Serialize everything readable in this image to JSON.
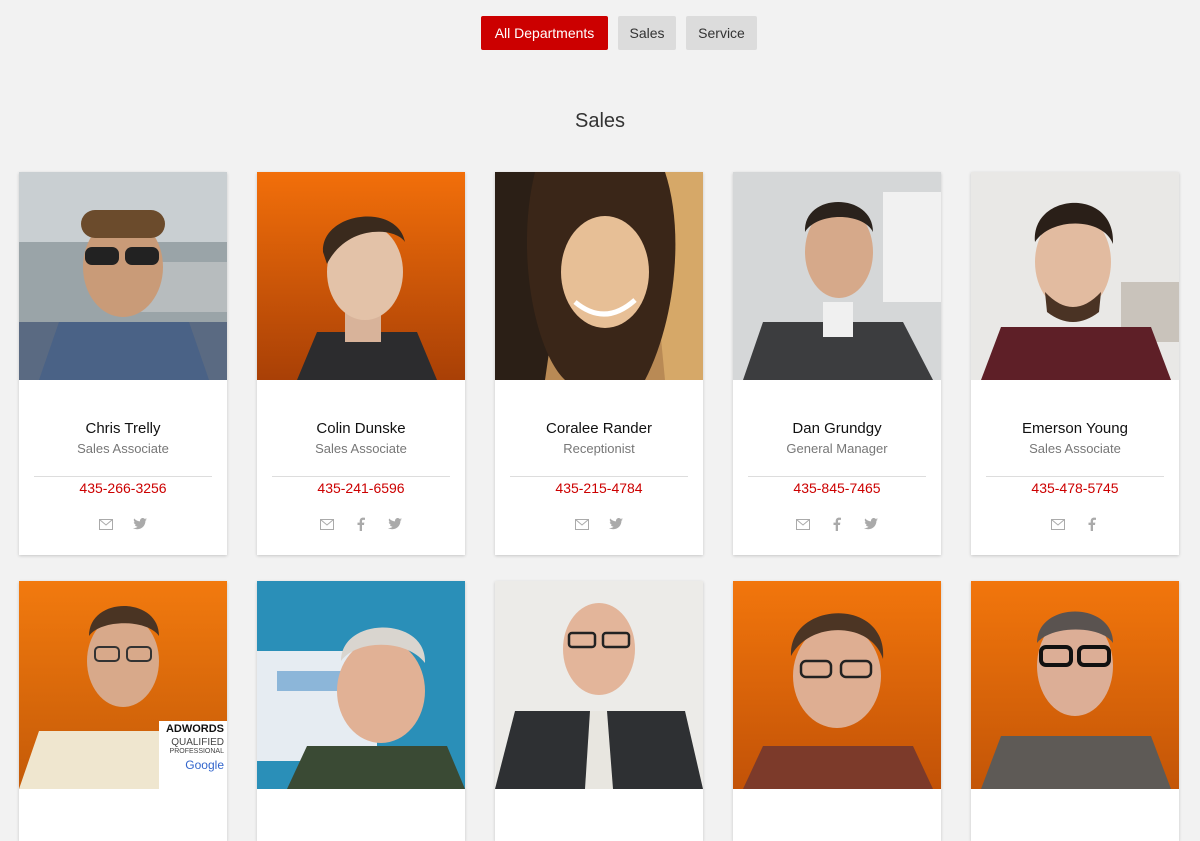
{
  "filters": [
    {
      "label": "All Departments",
      "active": true
    },
    {
      "label": "Sales",
      "active": false
    },
    {
      "label": "Service",
      "active": false
    }
  ],
  "section_title": "Sales",
  "colors": {
    "accent": "#cc0000",
    "orange_bg": "#f07a10"
  },
  "people": [
    {
      "name": "Chris Trelly",
      "role": "Sales Associate",
      "phone": "435-266-3256",
      "socials": [
        "email-icon",
        "twitter-icon"
      ]
    },
    {
      "name": "Colin Dunske",
      "role": "Sales Associate",
      "phone": "435-241-6596",
      "socials": [
        "email-icon",
        "facebook-icon",
        "twitter-icon"
      ]
    },
    {
      "name": "Coralee Rander",
      "role": "Receptionist",
      "phone": "435-215-4784",
      "socials": [
        "email-icon",
        "twitter-icon"
      ]
    },
    {
      "name": "Dan Grundgy",
      "role": "General Manager",
      "phone": "435-845-7465",
      "socials": [
        "email-icon",
        "facebook-icon",
        "twitter-icon"
      ]
    },
    {
      "name": "Emerson Young",
      "role": "Sales Associate",
      "phone": "435-478-5745",
      "socials": [
        "email-icon",
        "facebook-icon"
      ]
    }
  ],
  "adwords_badge": {
    "line1": "ADWORDS",
    "line2": "QUALIFIED",
    "line3": "PROFESSIONAL",
    "line4": "Google"
  }
}
